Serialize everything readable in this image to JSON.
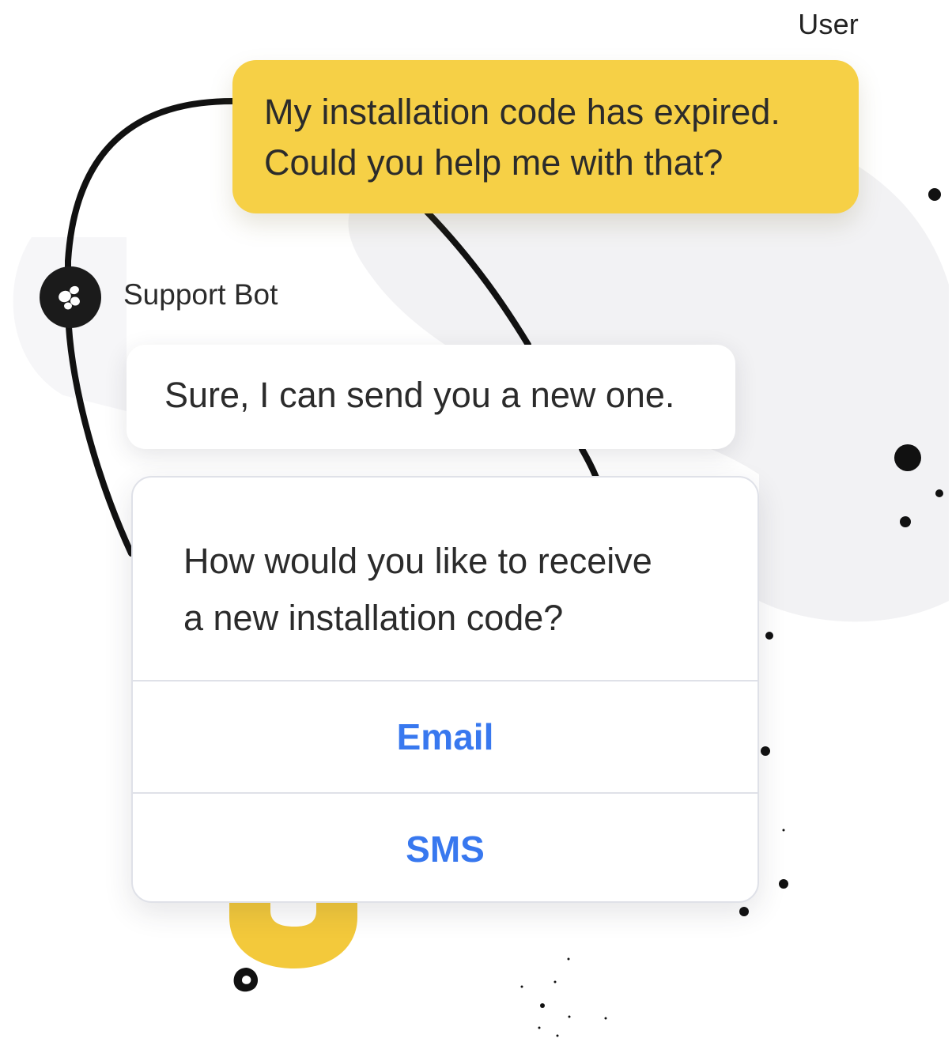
{
  "conversation": {
    "user": {
      "label": "User",
      "message_line1": "My installation code has expired.",
      "message_line2": "Could you help me with that?"
    },
    "bot": {
      "label": "Support Bot",
      "avatar_icon": "support-bot-logo-icon",
      "message": "Sure, I can send you a new one."
    },
    "choice": {
      "question_line1": "How would you like to receive",
      "question_line2": "a new installation code?",
      "options": [
        {
          "label": "Email"
        },
        {
          "label": "SMS"
        }
      ]
    }
  },
  "colors": {
    "user_bubble": "#f6d046",
    "accent_link": "#3878ef",
    "avatar": "#1b1b1b",
    "connector": "#111111"
  }
}
